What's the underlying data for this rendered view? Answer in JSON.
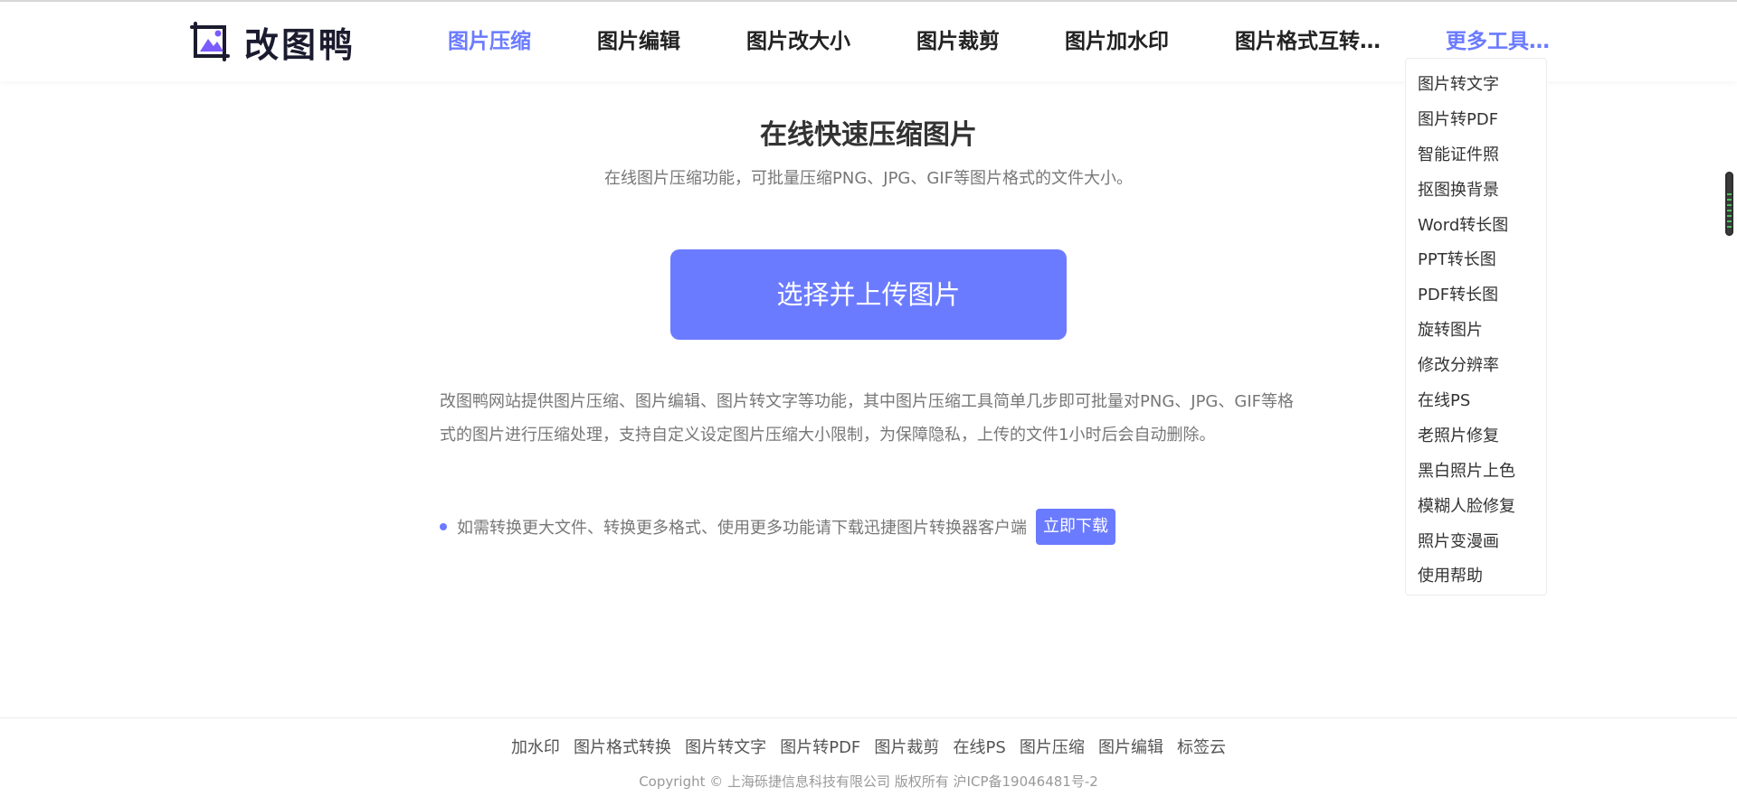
{
  "brand": {
    "name": "改图鸭",
    "logo_icon": "image-mountain-icon",
    "accent": "#6b7bff"
  },
  "nav": {
    "items": [
      {
        "label": "图片压缩",
        "active": true
      },
      {
        "label": "图片编辑"
      },
      {
        "label": "图片改大小"
      },
      {
        "label": "图片裁剪"
      },
      {
        "label": "图片加水印"
      },
      {
        "label": "图片格式互转…"
      }
    ],
    "more_label": "更多工具…"
  },
  "dropdown": {
    "items": [
      "图片转文字",
      "图片转PDF",
      "智能证件照",
      "抠图换背景",
      "Word转长图",
      "PPT转长图",
      "PDF转长图",
      "旋转图片",
      "修改分辨率",
      "在线PS",
      "老照片修复",
      "黑白照片上色",
      "模糊人脸修复",
      "照片变漫画",
      "使用帮助"
    ]
  },
  "main": {
    "title": "在线快速压缩图片",
    "subtitle": "在线图片压缩功能，可批量压缩PNG、JPG、GIF等图片格式的文件大小。",
    "upload_label": "选择并上传图片",
    "description": "改图鸭网站提供图片压缩、图片编辑、图片转文字等功能，其中图片压缩工具简单几步即可批量对PNG、JPG、GIF等格式的图片进行压缩处理，支持自定义设定图片压缩大小限制，为保障隐私，上传的文件1小时后会自动删除。",
    "tip_text": "如需转换更大文件、转换更多格式、使用更多功能请下载迅捷图片转换器客户端",
    "tip_button": "立即下载"
  },
  "footer": {
    "links": [
      "加水印",
      "图片格式转换",
      "图片转文字",
      "图片转PDF",
      "图片裁剪",
      "在线PS",
      "图片压缩",
      "图片编辑",
      "标签云"
    ],
    "copyright": "Copyright © 上海砾捷信息科技有限公司 版权所有 沪ICP备19046481号-2"
  }
}
